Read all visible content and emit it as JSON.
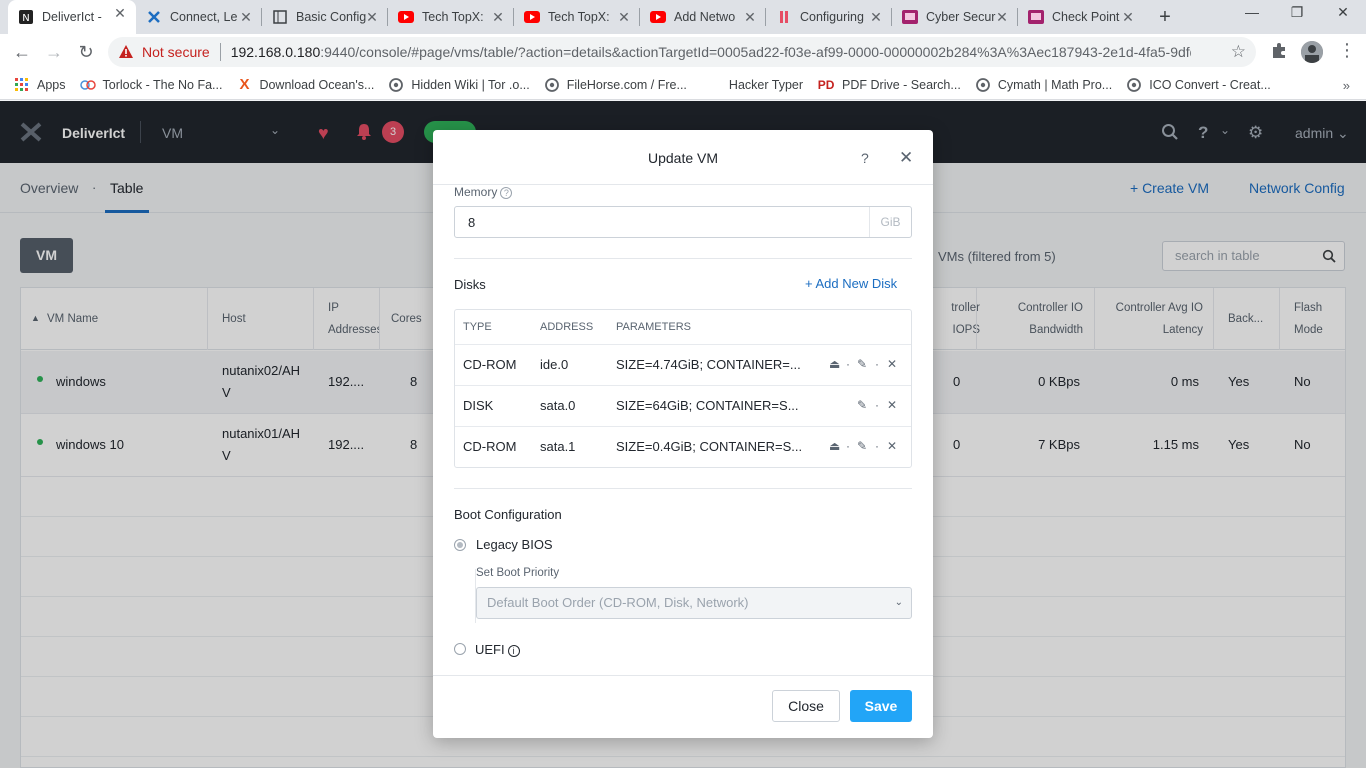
{
  "browser": {
    "tabs": [
      {
        "title": "DeliverIct - ",
        "icon": "nutanix-icon",
        "active": true
      },
      {
        "title": "Connect, Le",
        "icon": "nutanix-x-icon"
      },
      {
        "title": "Basic Config",
        "icon": "document-icon"
      },
      {
        "title": "Tech TopX: ",
        "icon": "youtube-icon"
      },
      {
        "title": "Tech TopX: ",
        "icon": "youtube-icon"
      },
      {
        "title": "Add Netwo",
        "icon": "youtube-icon"
      },
      {
        "title": "Configuring",
        "icon": "bookmark-icon"
      },
      {
        "title": "Cyber Secur",
        "icon": "course-icon"
      },
      {
        "title": "Check Point",
        "icon": "course-icon"
      }
    ],
    "address": {
      "security": "Not secure",
      "host": "192.168.0.180",
      "path": ":9440/console/#page/vms/table/?action=details&actionTargetId=0005ad22-f03e-af99-0000-00000002b284%3A%3Aec187943-2e1d-4fa5-9dfd-a..."
    },
    "bookmarks": [
      {
        "label": "Apps",
        "icon": "apps-grid-icon"
      },
      {
        "label": "Torlock - The No Fa...",
        "icon": "torlock-icon"
      },
      {
        "label": "Download Ocean's...",
        "icon": "x-logo-icon"
      },
      {
        "label": "Hidden Wiki | Tor .o...",
        "icon": "globe-icon"
      },
      {
        "label": "FileHorse.com / Fre...",
        "icon": "globe-icon"
      },
      {
        "label": "Hacker Typer",
        "icon": ""
      },
      {
        "label": "PDF Drive - Search...",
        "icon": "pdf-drive-icon"
      },
      {
        "label": "Cymath | Math Pro...",
        "icon": "globe-icon"
      },
      {
        "label": "ICO Convert - Creat...",
        "icon": "globe-icon"
      }
    ]
  },
  "app": {
    "name": "DeliverIct",
    "entity": "VM",
    "alert_count": "3",
    "user": "admin",
    "subtabs": [
      "Overview",
      "Table"
    ],
    "actions": {
      "create": "+ Create VM",
      "network": "Network Config"
    },
    "vm_button": "VM",
    "filter_text": "VMs (filtered from 5)",
    "search_placeholder": "search in table",
    "columns": [
      "VM Name",
      "Host",
      "IP Addresses",
      "Cores",
      "troller IOPS",
      "Controller IO Bandwidth",
      "Controller Avg IO Latency",
      "Back...",
      "Flash Mode"
    ],
    "rows": [
      {
        "name": "windows",
        "host": "nutanix02/AHV",
        "ip": "192....",
        "cores": "8",
        "iops": "0",
        "bandwidth": "0 KBps",
        "latency": "0 ms",
        "backup": "Yes",
        "flash": "No"
      },
      {
        "name": "windows 10",
        "host": "nutanix01/AHV",
        "ip": "192....",
        "cores": "8",
        "iops": "0",
        "bandwidth": "7 KBps",
        "latency": "1.15 ms",
        "backup": "Yes",
        "flash": "No"
      }
    ]
  },
  "modal": {
    "title": "Update VM",
    "help": "?",
    "close_x": "✕",
    "memory_label": "Memory",
    "memory_value": "8",
    "memory_unit": "GiB",
    "disks_title": "Disks",
    "add_disk": "+ Add New Disk",
    "disk_columns": [
      "TYPE",
      "ADDRESS",
      "PARAMETERS"
    ],
    "disks": [
      {
        "type": "CD-ROM",
        "address": "ide.0",
        "params": "SIZE=4.74GiB; CONTAINER=...",
        "ejectable": true
      },
      {
        "type": "DISK",
        "address": "sata.0",
        "params": "SIZE=64GiB; CONTAINER=S...",
        "ejectable": false
      },
      {
        "type": "CD-ROM",
        "address": "sata.1",
        "params": "SIZE=0.4GiB; CONTAINER=S...",
        "ejectable": true
      }
    ],
    "boot_title": "Boot Configuration",
    "legacy_label": "Legacy BIOS",
    "boot_priority_label": "Set Boot Priority",
    "boot_priority_value": "Default Boot Order (CD-ROM, Disk, Network)",
    "uefi_label": "UEFI",
    "close_button": "Close",
    "save_button": "Save"
  }
}
